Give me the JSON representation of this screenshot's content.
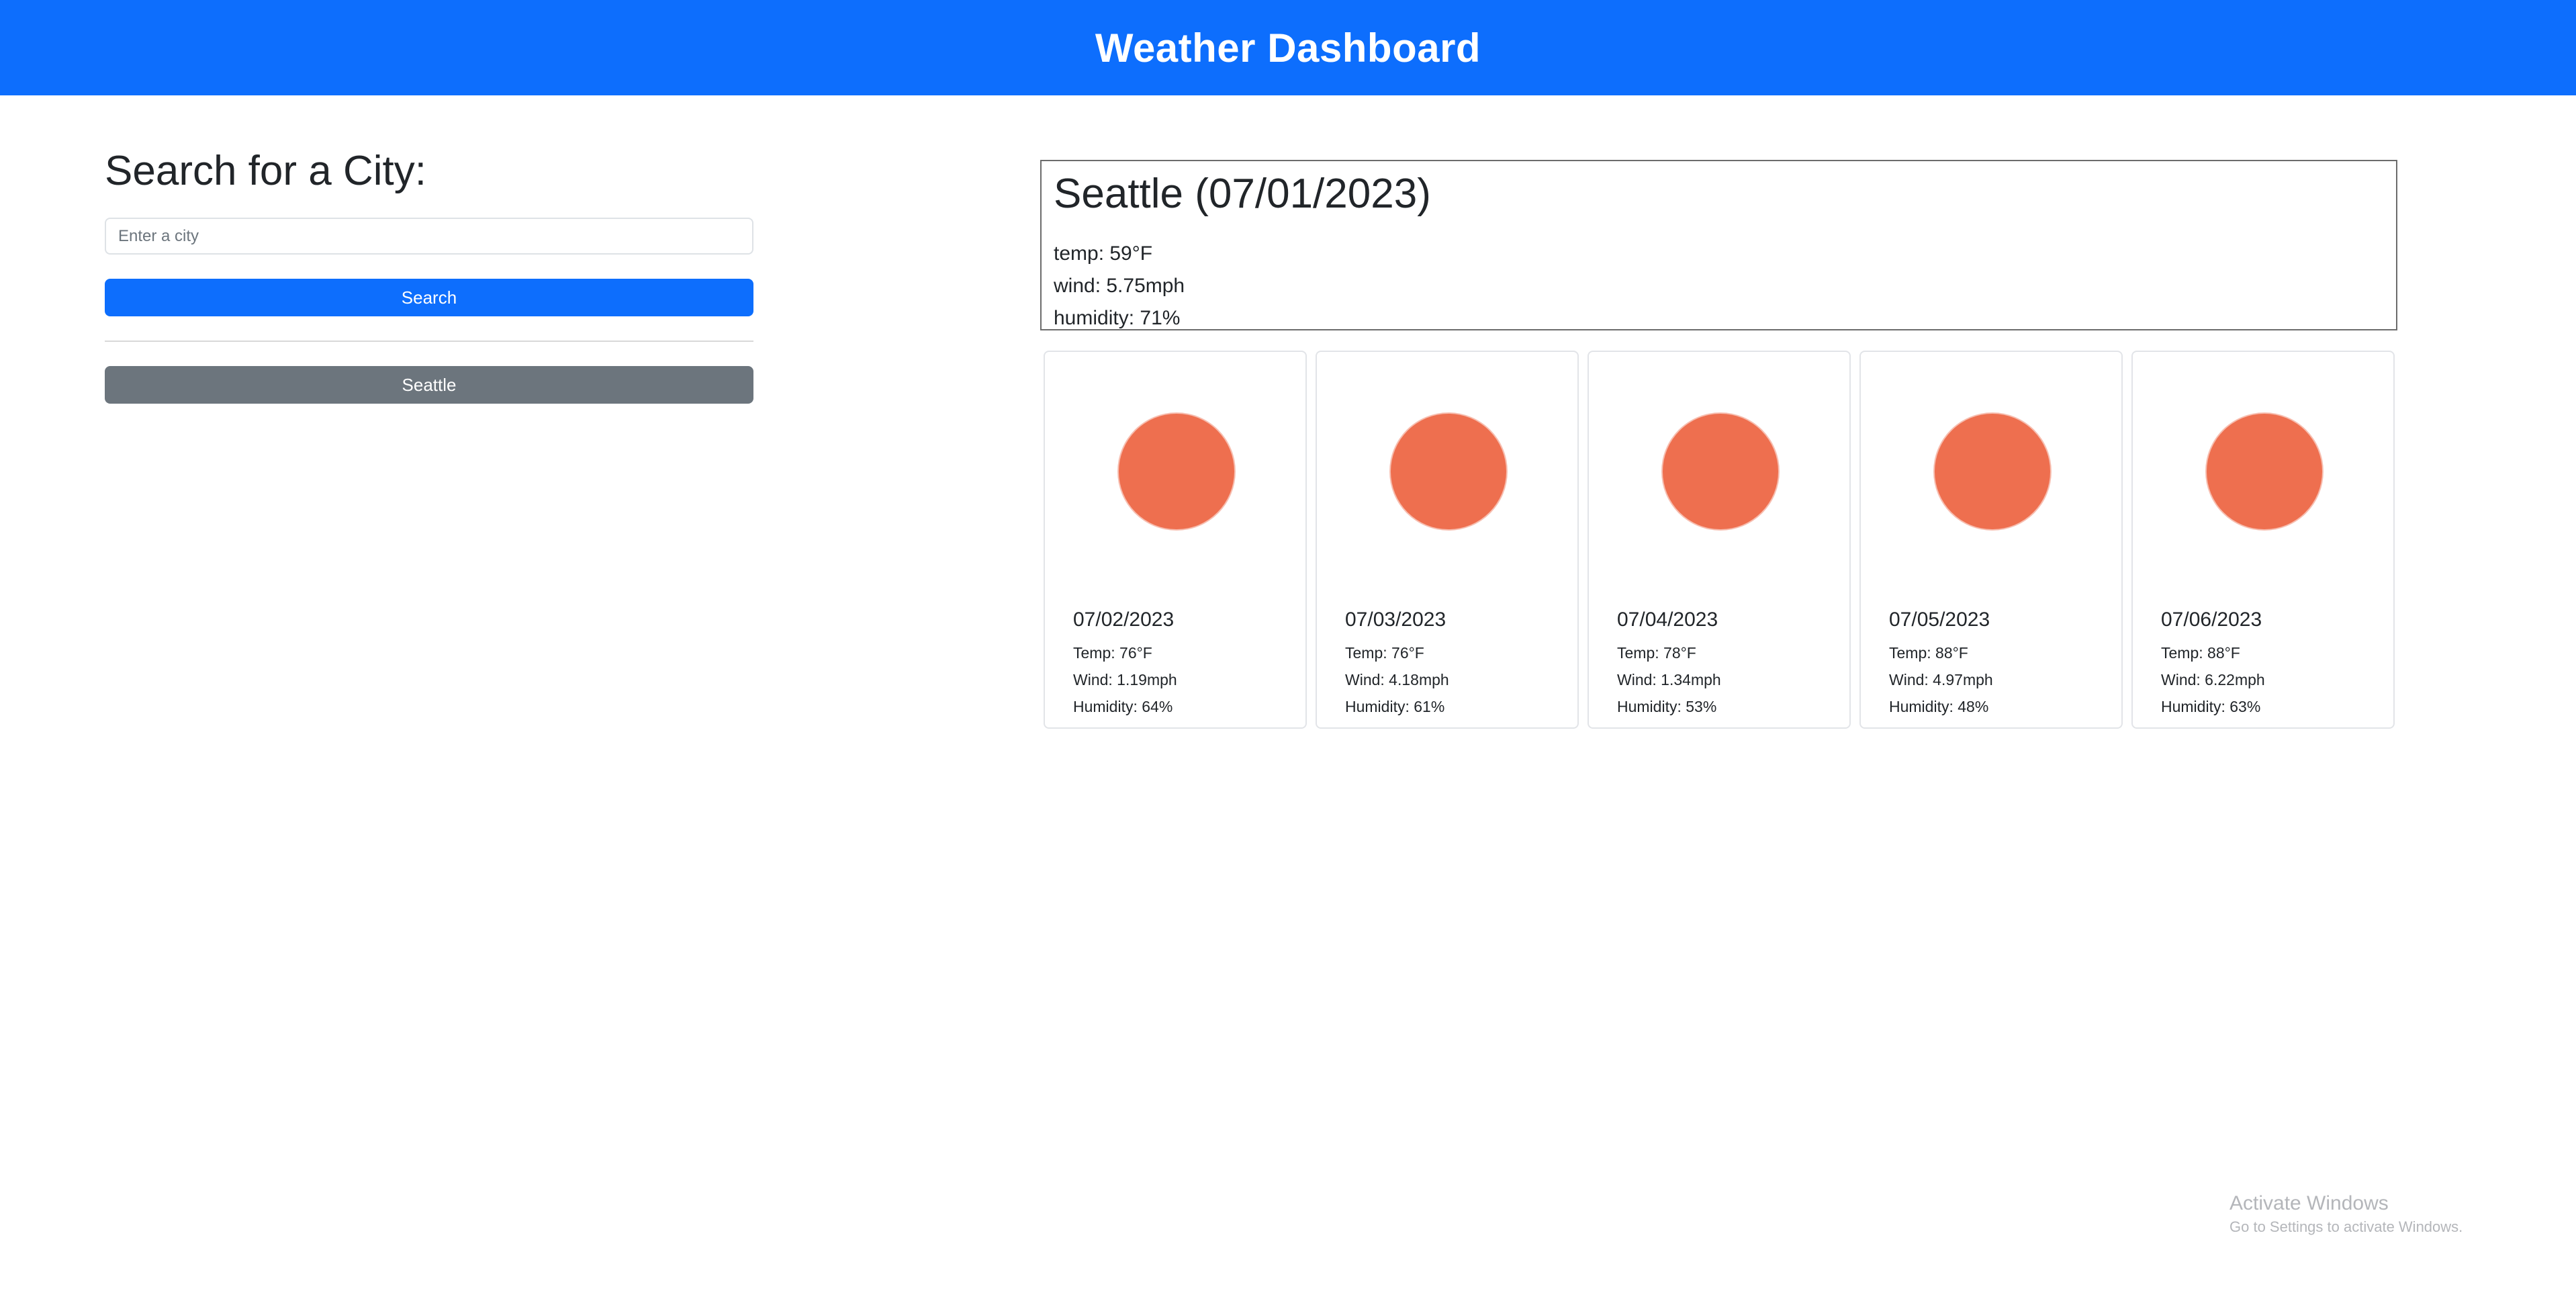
{
  "header": {
    "title": "Weather Dashboard"
  },
  "search": {
    "heading": "Search for a City:",
    "placeholder": "Enter a city",
    "value": "",
    "button_label": "Search"
  },
  "history": {
    "items": [
      {
        "label": "Seattle"
      }
    ]
  },
  "current": {
    "title": "Seattle (07/01/2023)",
    "temp": "temp: 59°F",
    "wind": "wind: 5.75mph",
    "humidity": "humidity: 71%"
  },
  "forecast": [
    {
      "date": "07/02/2023",
      "temp": "Temp: 76°F",
      "wind": "Wind: 1.19mph",
      "humidity": "Humidity: 64%",
      "icon": "sun-icon"
    },
    {
      "date": "07/03/2023",
      "temp": "Temp: 76°F",
      "wind": "Wind: 4.18mph",
      "humidity": "Humidity: 61%",
      "icon": "sun-icon"
    },
    {
      "date": "07/04/2023",
      "temp": "Temp: 78°F",
      "wind": "Wind: 1.34mph",
      "humidity": "Humidity: 53%",
      "icon": "sun-icon"
    },
    {
      "date": "07/05/2023",
      "temp": "Temp: 88°F",
      "wind": "Wind: 4.97mph",
      "humidity": "Humidity: 48%",
      "icon": "sun-icon"
    },
    {
      "date": "07/06/2023",
      "temp": "Temp: 88°F",
      "wind": "Wind: 6.22mph",
      "humidity": "Humidity: 63%",
      "icon": "sun-icon"
    }
  ],
  "watermark": {
    "title": "Activate Windows",
    "subtitle": "Go to Settings to activate Windows."
  },
  "colors": {
    "header_bg": "#0d6efd",
    "primary_button": "#0d6efd",
    "history_button": "#6c757d",
    "sun": "#ee6f4f"
  }
}
